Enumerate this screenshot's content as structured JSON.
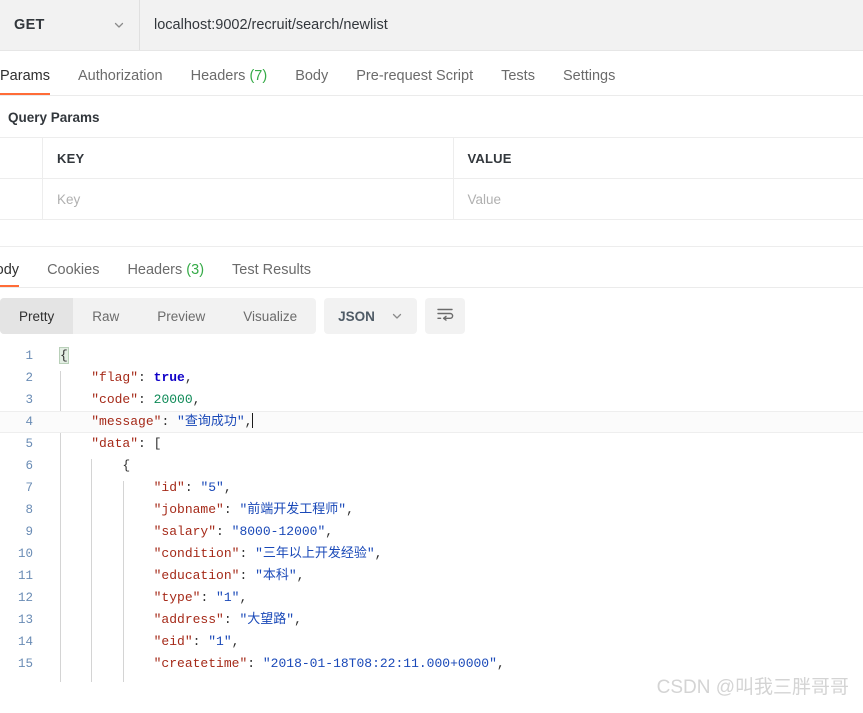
{
  "request_bar": {
    "method": "GET",
    "method_icon": "chevron-down-icon",
    "url": "localhost:9002/recruit/search/newlist"
  },
  "request_tabs": [
    {
      "label": "Params",
      "count": "",
      "active": true
    },
    {
      "label": "Authorization",
      "count": "",
      "active": false
    },
    {
      "label": "Headers",
      "count": "(7)",
      "active": false
    },
    {
      "label": "Body",
      "count": "",
      "active": false
    },
    {
      "label": "Pre-request Script",
      "count": "",
      "active": false
    },
    {
      "label": "Tests",
      "count": "",
      "active": false
    },
    {
      "label": "Settings",
      "count": "",
      "active": false
    }
  ],
  "query_params": {
    "title": "Query Params",
    "headers": {
      "key": "KEY",
      "value": "VALUE"
    },
    "rows": [
      {
        "key_placeholder": "Key",
        "value_placeholder": "Value"
      }
    ]
  },
  "response_tabs": [
    {
      "label": "Body",
      "count": "",
      "active": true
    },
    {
      "label": "Cookies",
      "count": "",
      "active": false
    },
    {
      "label": "Headers",
      "count": "(3)",
      "active": false
    },
    {
      "label": "Test Results",
      "count": "",
      "active": false
    }
  ],
  "format_toolbar": {
    "segments": [
      {
        "label": "Pretty",
        "active": true
      },
      {
        "label": "Raw",
        "active": false
      },
      {
        "label": "Preview",
        "active": false
      },
      {
        "label": "Visualize",
        "active": false
      }
    ],
    "language": "JSON",
    "language_icon": "chevron-down-icon",
    "wrap_icon": "word-wrap-icon"
  },
  "colors": {
    "accent": "#ff6c37",
    "count_green": "#36ab48",
    "json_key": "#a52a19",
    "json_string": "#1a49b8",
    "json_number": "#0e8a57",
    "json_boolean": "#0f00c8",
    "line_number": "#6a8cb5",
    "toolbar_bg": "#f2f2f2"
  },
  "code": {
    "active_line": 4,
    "lines": [
      {
        "n": "1",
        "indent": 0,
        "tokens": [
          {
            "t": "brace-match",
            "v": "{"
          }
        ]
      },
      {
        "n": "2",
        "indent": 1,
        "tokens": [
          {
            "t": "key",
            "v": "\"flag\""
          },
          {
            "t": "punct",
            "v": ": "
          },
          {
            "t": "bool",
            "v": "true"
          },
          {
            "t": "punct",
            "v": ","
          }
        ]
      },
      {
        "n": "3",
        "indent": 1,
        "tokens": [
          {
            "t": "key",
            "v": "\"code\""
          },
          {
            "t": "punct",
            "v": ": "
          },
          {
            "t": "num",
            "v": "20000"
          },
          {
            "t": "punct",
            "v": ","
          }
        ]
      },
      {
        "n": "4",
        "indent": 1,
        "tokens": [
          {
            "t": "key",
            "v": "\"message\""
          },
          {
            "t": "punct",
            "v": ": "
          },
          {
            "t": "str",
            "v": "\"查询成功\""
          },
          {
            "t": "punct",
            "v": ","
          },
          {
            "t": "caret",
            "v": ""
          }
        ]
      },
      {
        "n": "5",
        "indent": 1,
        "tokens": [
          {
            "t": "key",
            "v": "\"data\""
          },
          {
            "t": "punct",
            "v": ": "
          },
          {
            "t": "brace",
            "v": "["
          }
        ]
      },
      {
        "n": "6",
        "indent": 2,
        "tokens": [
          {
            "t": "brace",
            "v": "{"
          }
        ]
      },
      {
        "n": "7",
        "indent": 3,
        "tokens": [
          {
            "t": "key",
            "v": "\"id\""
          },
          {
            "t": "punct",
            "v": ": "
          },
          {
            "t": "str",
            "v": "\"5\""
          },
          {
            "t": "punct",
            "v": ","
          }
        ]
      },
      {
        "n": "8",
        "indent": 3,
        "tokens": [
          {
            "t": "key",
            "v": "\"jobname\""
          },
          {
            "t": "punct",
            "v": ": "
          },
          {
            "t": "str",
            "v": "\"前端开发工程师\""
          },
          {
            "t": "punct",
            "v": ","
          }
        ]
      },
      {
        "n": "9",
        "indent": 3,
        "tokens": [
          {
            "t": "key",
            "v": "\"salary\""
          },
          {
            "t": "punct",
            "v": ": "
          },
          {
            "t": "str",
            "v": "\"8000-12000\""
          },
          {
            "t": "punct",
            "v": ","
          }
        ]
      },
      {
        "n": "10",
        "indent": 3,
        "tokens": [
          {
            "t": "key",
            "v": "\"condition\""
          },
          {
            "t": "punct",
            "v": ": "
          },
          {
            "t": "str",
            "v": "\"三年以上开发经验\""
          },
          {
            "t": "punct",
            "v": ","
          }
        ]
      },
      {
        "n": "11",
        "indent": 3,
        "tokens": [
          {
            "t": "key",
            "v": "\"education\""
          },
          {
            "t": "punct",
            "v": ": "
          },
          {
            "t": "str",
            "v": "\"本科\""
          },
          {
            "t": "punct",
            "v": ","
          }
        ]
      },
      {
        "n": "12",
        "indent": 3,
        "tokens": [
          {
            "t": "key",
            "v": "\"type\""
          },
          {
            "t": "punct",
            "v": ": "
          },
          {
            "t": "str",
            "v": "\"1\""
          },
          {
            "t": "punct",
            "v": ","
          }
        ]
      },
      {
        "n": "13",
        "indent": 3,
        "tokens": [
          {
            "t": "key",
            "v": "\"address\""
          },
          {
            "t": "punct",
            "v": ": "
          },
          {
            "t": "str",
            "v": "\"大望路\""
          },
          {
            "t": "punct",
            "v": ","
          }
        ]
      },
      {
        "n": "14",
        "indent": 3,
        "tokens": [
          {
            "t": "key",
            "v": "\"eid\""
          },
          {
            "t": "punct",
            "v": ": "
          },
          {
            "t": "str",
            "v": "\"1\""
          },
          {
            "t": "punct",
            "v": ","
          }
        ]
      },
      {
        "n": "15",
        "indent": 3,
        "tokens": [
          {
            "t": "key",
            "v": "\"createtime\""
          },
          {
            "t": "punct",
            "v": ": "
          },
          {
            "t": "str",
            "v": "\"2018-01-18T08:22:11.000+0000\""
          },
          {
            "t": "punct",
            "v": ","
          }
        ]
      }
    ]
  },
  "watermark": "CSDN @叫我三胖哥哥"
}
